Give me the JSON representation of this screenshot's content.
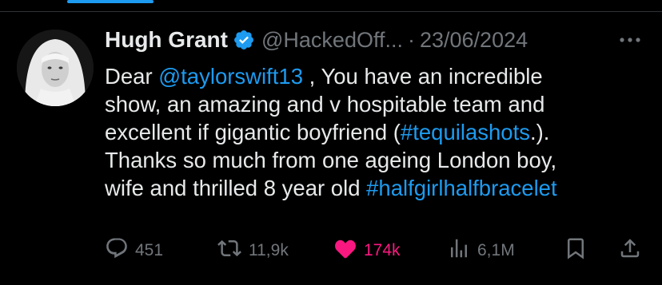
{
  "author": {
    "display_name": "Hugh Grant",
    "handle": "@HackedOff...",
    "separator": "·",
    "timestamp": "23/06/2024",
    "verified": true
  },
  "tweet": {
    "lines": [
      [
        {
          "t": "Dear "
        },
        {
          "t": "@taylorswift13",
          "link": true
        },
        {
          "t": " , You have an incredible"
        }
      ],
      [
        {
          "t": "show, an amazing and v hospitable team and"
        }
      ],
      [
        {
          "t": "excellent if gigantic boyfriend ("
        },
        {
          "t": "#tequilashots",
          "link": true
        },
        {
          "t": ".)."
        }
      ],
      [
        {
          "t": "Thanks so much from one ageing London boy,"
        }
      ],
      [
        {
          "t": "wife and thrilled 8 year old "
        },
        {
          "t": "#halfgirlhalfbracelet",
          "link": true
        }
      ]
    ]
  },
  "actions": {
    "replies": "451",
    "reposts": "11,9k",
    "likes": "174k",
    "views": "6,1M"
  },
  "colors": {
    "accent": "#1d9bf0",
    "like": "#f91880",
    "muted": "#71767b",
    "text": "#e7e9ea",
    "background": "#000000"
  },
  "icons": [
    "verified-badge-icon",
    "more-icon",
    "reply-icon",
    "repost-icon",
    "like-icon",
    "views-icon",
    "bookmark-icon",
    "share-icon"
  ]
}
